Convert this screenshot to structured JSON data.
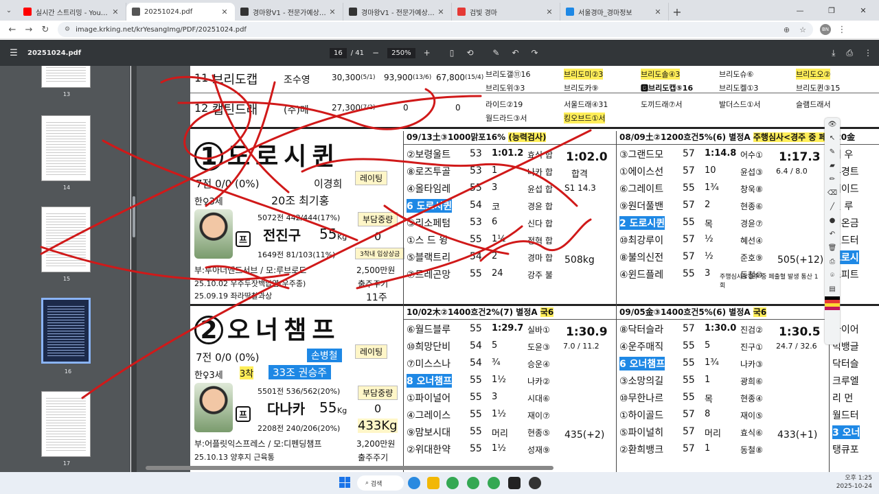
{
  "browser": {
    "tabs": [
      {
        "title": "실시간 스트리밍 - YouTube Stu",
        "color": "#ff0000",
        "active": false
      },
      {
        "title": "20251024.pdf",
        "color": "#555555",
        "active": true
      },
      {
        "title": "경마왕V1 - 전문가예상·분석글",
        "color": "#333333",
        "active": false
      },
      {
        "title": "경마왕V1 - 전문가예상·분석글",
        "color": "#333333",
        "active": false
      },
      {
        "title": "검빛 경마",
        "color": "#e53935",
        "active": false
      },
      {
        "title": "서울경마_경마정보",
        "color": "#1e88e5",
        "active": false
      }
    ],
    "url": "image.krking.net/krYesangImg/PDF/20251024.pdf",
    "profile": "BN"
  },
  "pdf": {
    "filename": "20251024.pdf",
    "page": "16",
    "total": "/ 41",
    "zoom": "250%",
    "thumbs": [
      "13",
      "14",
      "15",
      "16",
      "17"
    ]
  },
  "doc": {
    "top_rows": [
      {
        "num": "11",
        "horse": "브리도캡",
        "jockey": "조수영",
        "c1": "30,300",
        "c1s": "(5/1)",
        "c2": "93,900",
        "c2s": "(13/6)",
        "c3": "67,800",
        "c3s": "(15/4)",
        "rel": [
          "브리도갤⑪16",
          "브리도미②3",
          "브리도솔④3",
          "브리도슈⑥",
          "브리도오②",
          "브리도위③3",
          "브리도카⑨",
          "🅱브리도캡⑤16",
          "브리도켈①3",
          "브리도퀸③15"
        ]
      },
      {
        "num": "12",
        "horse": "캡틴드래",
        "jockey": "(주)메",
        "c1": "27,300",
        "c1s": "(7/2)",
        "c2": "0",
        "c2s": "",
        "c3": "0",
        "c3s": "",
        "rel": [
          "라이드②19",
          "서울드래④31",
          "도끼드래⑦서",
          "발더스드①서",
          "슬램드래서",
          "월드라드③서",
          "킹오브드①서"
        ]
      }
    ],
    "horse1": {
      "name": "도로시퀸",
      "num": "1",
      "record": "7전 0/0 (0%)",
      "owner": "이경희",
      "sex_age": "한♀3세",
      "trainer": "20조 최기홍",
      "rating_label": "레이팅",
      "weight_label": "부담중량",
      "jockey_stats": "5072전 442/444(17%)",
      "jockey": "전진구",
      "jockey_wt": "55",
      "kg": "Kg",
      "weight_val": "0",
      "jockey_stats2": "1649전 81/103(11%)",
      "sire": "부:투아너앤드서브 / 모:루브로드",
      "prize": "2,500만원",
      "prize_label": "3착내 입상상금",
      "hist": [
        "25.10.02 우주두잣백납염(우주종)",
        "25.09.19 좌라딱찰과상"
      ],
      "cycle_label": "출주주기",
      "cycle": "11주",
      "badge": "프"
    },
    "horse2": {
      "name": "오너챔프",
      "num": "2",
      "record": "7전 0/0 (0%)",
      "owner": "손병철",
      "sex_age": "한♀3세",
      "finish": "3착",
      "trainer": "33조 권승주",
      "rating_label": "레이팅",
      "weight_label": "부담중량",
      "jockey_stats": "5501전 536/562(20%)",
      "jockey": "다나카",
      "jockey_wt": "55",
      "kg": "Kg",
      "weight_val": "0",
      "wt": "433Kg",
      "jockey_stats2": "2208전 240/206(20%)",
      "sire": "부:어플릿익스프레스 / 모:디펜딩챔프",
      "prize": "3,200만원",
      "hist": [
        "25.10.13 양후지 근육통"
      ],
      "cycle_label": "출주주기",
      "badge": "프"
    },
    "race1": {
      "head": "09/13土③1000맑포16%",
      "note": "(능력검사)",
      "rows": [
        {
          "h": "②보령울트",
          "w": "53",
          "m": "1:01.2",
          "j": "효식 합"
        },
        {
          "h": "⑧로즈투골",
          "w": "53",
          "m": "1",
          "j": "나카 합"
        },
        {
          "h": "④올타임레",
          "w": "55",
          "m": "3",
          "j": "윤섭 합"
        },
        {
          "h": "6 도로시퀸",
          "w": "54",
          "m": "코",
          "j": "경윤 합",
          "sel": true
        },
        {
          "h": "③리소페텀",
          "w": "53",
          "m": "6",
          "j": "신다 합"
        },
        {
          "h": "①스 드 윙",
          "w": "55",
          "m": "1½",
          "j": "정혁 합"
        },
        {
          "h": "⑤블랙트리",
          "w": "54",
          "m": "2",
          "j": "경마 합"
        },
        {
          "h": "⑦트레곤망",
          "w": "55",
          "m": "24",
          "j": "강주 불"
        }
      ],
      "time": "1:02.0",
      "result": "합격",
      "s1": "S1 14.3",
      "kg": "508kg"
    },
    "race2": {
      "head": "08/09土②1200흐건5%(6) 별정A",
      "grade": "국6",
      "rows": [
        {
          "h": "③그랜드모",
          "w": "57",
          "m": "1:14.8",
          "j": "어수①"
        },
        {
          "h": "①에이스선",
          "w": "57",
          "m": "10",
          "j": "윤섭③"
        },
        {
          "h": "⑥그레이트",
          "w": "55",
          "m": "1¾",
          "j": "창욱⑧"
        },
        {
          "h": "⑨원더풀밴",
          "w": "57",
          "m": "2",
          "j": "현종⑥"
        },
        {
          "h": "2 도로시퀸",
          "w": "55",
          "m": "목",
          "j": "경윤⑦",
          "sel": true
        },
        {
          "h": "⑩최강루이",
          "w": "57",
          "m": "½",
          "j": "혜선④"
        },
        {
          "h": "⑧불의신전",
          "w": "57",
          "m": "½",
          "j": "준호⑨"
        },
        {
          "h": "④윈드플레",
          "w": "55",
          "m": "3",
          "j": "동철⑩"
        }
      ],
      "time": "1:17.3",
      "pace": "6.4 / 8.0",
      "kg": "505(+12)",
      "note": "주행심사<경주 중 페출혈 발생 통산 1회"
    },
    "race3": {
      "head": "10/02木②1400흐건2%(7) 별정A",
      "grade": "국6",
      "rows": [
        {
          "h": "⑥월드블루",
          "w": "55",
          "m": "1:29.7",
          "j": "실바①"
        },
        {
          "h": "⑩희망단비",
          "w": "54",
          "m": "5",
          "j": "도윤③"
        },
        {
          "h": "⑦미스스나",
          "w": "54",
          "m": "¾",
          "j": "승운④"
        },
        {
          "h": "8 오너챔프",
          "w": "55",
          "m": "1½",
          "j": "나카②",
          "sel": true
        },
        {
          "h": "①파이널어",
          "w": "55",
          "m": "3",
          "j": "시대⑥"
        },
        {
          "h": "④그레이스",
          "w": "55",
          "m": "1½",
          "j": "재이⑦"
        },
        {
          "h": "⑨맘보시대",
          "w": "55",
          "m": "머리",
          "j": "현종⑤"
        },
        {
          "h": "②위대한약",
          "w": "55",
          "m": "1½",
          "j": "성재⑨"
        }
      ],
      "time": "1:30.9",
      "pace": "7.0 / 11.2",
      "kg": "435(+2)"
    },
    "race4": {
      "head": "09/05金③1400흐건5%(6) 별정A",
      "grade": "국6",
      "rows": [
        {
          "h": "⑧닥터슬라",
          "w": "57",
          "m": "1:30.0",
          "j": "진검②"
        },
        {
          "h": "④운주매직",
          "w": "55",
          "m": "5",
          "j": "진구①"
        },
        {
          "h": "6 오너챔프",
          "w": "55",
          "m": "1¾",
          "j": "나카③",
          "sel": true
        },
        {
          "h": "③소망의길",
          "w": "55",
          "m": "1",
          "j": "광희⑥"
        },
        {
          "h": "⑩무한나르",
          "w": "55",
          "m": "목",
          "j": "현종④"
        },
        {
          "h": "①하이골드",
          "w": "57",
          "m": "8",
          "j": "재이⑤"
        },
        {
          "h": "⑤파이널히",
          "w": "57",
          "m": "머리",
          "j": "효식⑥"
        },
        {
          "h": "②환희뱅크",
          "w": "57",
          "m": "1",
          "j": "동철⑧"
        }
      ],
      "time": "1:30.5",
      "pace": "24.7 / 32.6",
      "kg": "433(+1)"
    },
    "race5_partial": [
      "테 우",
      "부경트",
      "제이드",
      "일 루",
      "컴온금",
      "월드터",
      "도로시",
      "스피트",
      "다이어",
      "빅뱅글",
      "닥터슬",
      "크루엘",
      "리 먼",
      "월드터",
      "3 오너",
      "탱큐포"
    ],
    "race5_head": "/20金"
  },
  "taskbar": {
    "search": "검색",
    "time": "오후 1:25",
    "date": "2025-10-24"
  },
  "colors": {
    "ink": "#d01919",
    "pdf_bg": "#525659",
    "sel": "#1e88e5"
  }
}
